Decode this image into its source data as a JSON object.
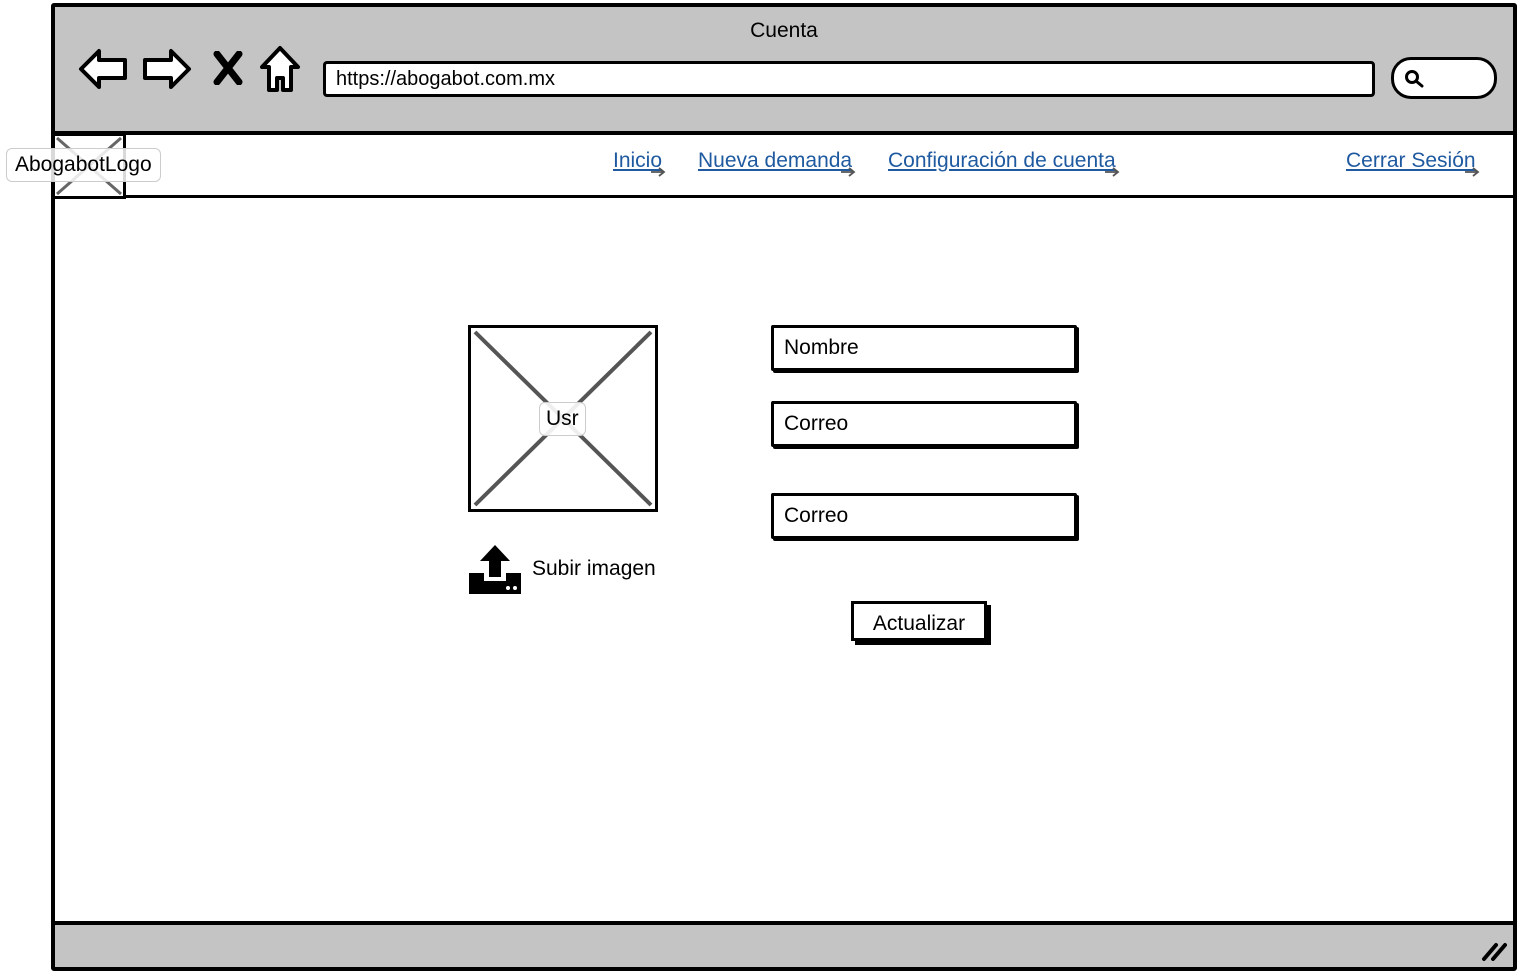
{
  "window": {
    "title": "Cuenta",
    "url": "https://abogabot.com.mx"
  },
  "toolbar": {
    "icons": [
      "back-arrow-icon",
      "forward-arrow-icon",
      "stop-x-icon",
      "home-icon",
      "search-icon"
    ]
  },
  "menubar": {
    "logo_label": "AbogabotLogo",
    "links": [
      {
        "label": "Inicio"
      },
      {
        "label": "Nueva demanda"
      },
      {
        "label": "Configuración de cuenta"
      },
      {
        "label": "Cerrar Sesión"
      }
    ]
  },
  "profile": {
    "avatar_label": "Usr",
    "upload_label": "Subir imagen"
  },
  "form": {
    "name_placeholder": "Nombre",
    "email_placeholder": "Correo",
    "email2_placeholder": "Correo",
    "submit_label": "Actualizar"
  },
  "colors": {
    "chrome": "#c4c4c4",
    "link": "#1f5aa0",
    "border": "#000000"
  }
}
